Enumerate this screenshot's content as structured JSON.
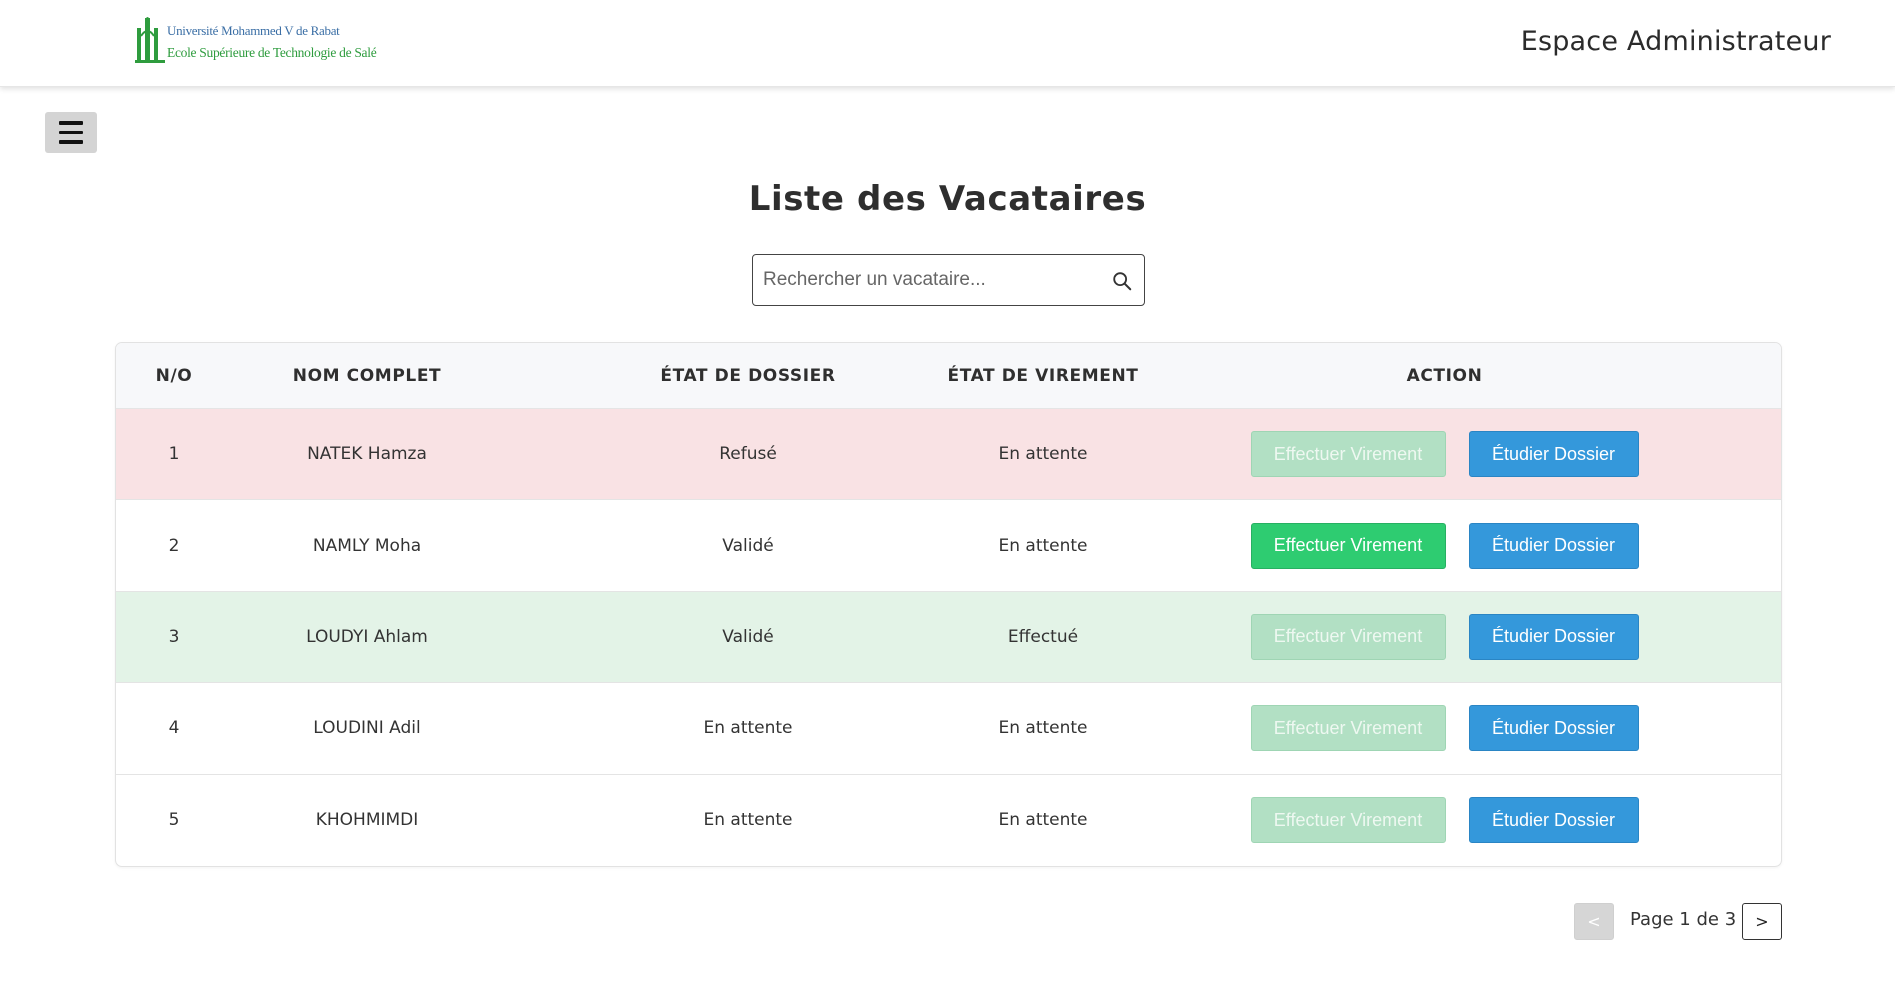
{
  "header": {
    "logo_line1": "Université Mohammed V de Rabat",
    "logo_line2": "Ecole Supérieure de Technologie de Salé",
    "title": "Espace Administrateur"
  },
  "menu": {
    "icon": "hamburger-menu-icon"
  },
  "page": {
    "title": "Liste des Vacataires"
  },
  "search": {
    "placeholder": "Rechercher un vacataire...",
    "value": "",
    "icon": "search-icon"
  },
  "table": {
    "headers": [
      "N/O",
      "NOM COMPLET",
      "ÉTAT DE DOSSIER",
      "ÉTAT DE VIREMENT",
      "ACTION"
    ],
    "rows": [
      {
        "no": "1",
        "nom": "NATEK Hamza",
        "dossier": "Refusé",
        "virement": "En attente",
        "virement_btn": "Effectuer Virement",
        "dossier_btn": "Étudier Dossier",
        "virement_enabled": false,
        "row_status": "refused"
      },
      {
        "no": "2",
        "nom": "NAMLY Moha",
        "dossier": "Validé",
        "virement": "En attente",
        "virement_btn": "Effectuer Virement",
        "dossier_btn": "Étudier Dossier",
        "virement_enabled": true,
        "row_status": "normal"
      },
      {
        "no": "3",
        "nom": "LOUDYI Ahlam",
        "dossier": "Validé",
        "virement": "Effectué",
        "virement_btn": "Effectuer Virement",
        "dossier_btn": "Étudier Dossier",
        "virement_enabled": false,
        "row_status": "done"
      },
      {
        "no": "4",
        "nom": "LOUDINI Adil",
        "dossier": "En attente",
        "virement": "En attente",
        "virement_btn": "Effectuer Virement",
        "dossier_btn": "Étudier Dossier",
        "virement_enabled": false,
        "row_status": "normal"
      },
      {
        "no": "5",
        "nom": "KHOHMIMDI",
        "dossier": "En attente",
        "virement": "En attente",
        "virement_btn": "Effectuer Virement",
        "dossier_btn": "Étudier Dossier",
        "virement_enabled": false,
        "row_status": "normal"
      }
    ]
  },
  "pagination": {
    "prev_label": "<",
    "text": "Page 1 de 3",
    "next_label": ">",
    "current": 1,
    "total": 3
  },
  "colors": {
    "refused_row": "#f9e2e4",
    "done_row": "#e3f3e7",
    "virement_button": "#2ecc71",
    "virement_button_disabled": "#b2e0c4",
    "dossier_button": "#3498db"
  }
}
